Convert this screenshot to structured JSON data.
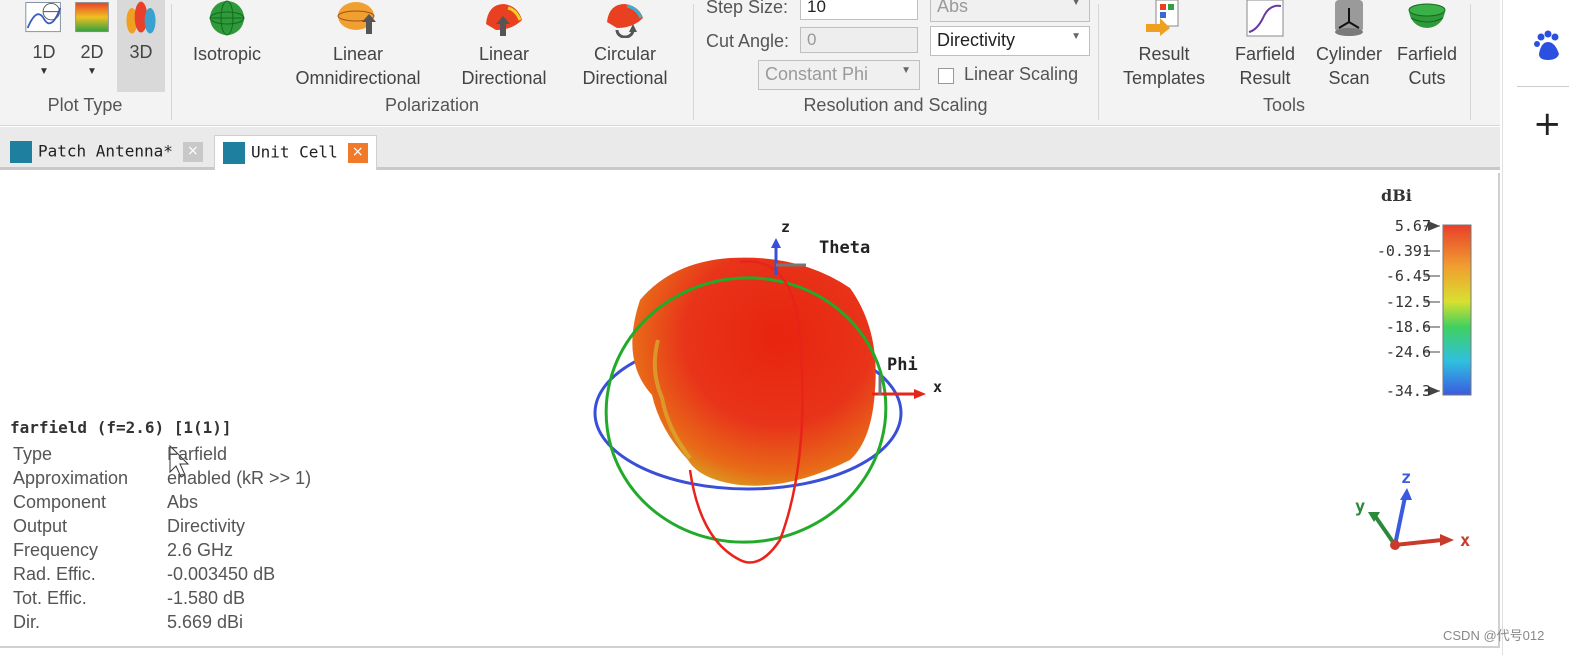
{
  "ribbon": {
    "plot_type": {
      "label": "Plot Type",
      "buttons": [
        {
          "label": "1D"
        },
        {
          "label": "2D"
        },
        {
          "label": "3D"
        }
      ]
    },
    "polarization": {
      "label": "Polarization",
      "buttons": [
        {
          "label1": "Isotropic",
          "label2": ""
        },
        {
          "label1": "Linear",
          "label2": "Omnidirectional"
        },
        {
          "label1": "Linear",
          "label2": "Directional"
        },
        {
          "label1": "Circular",
          "label2": "Directional"
        }
      ]
    },
    "resolution": {
      "label": "Resolution and Scaling",
      "step_size_label": "Step Size:",
      "step_size_value": "10",
      "cut_angle_label": "Cut Angle:",
      "cut_angle_value": "0",
      "component_value": "Abs",
      "output_value": "Directivity",
      "cut_type_value": "Constant Phi",
      "linear_scaling_label": "Linear Scaling"
    },
    "tools": {
      "label": "Tools",
      "buttons": [
        {
          "label1": "Result",
          "label2": "Templates"
        },
        {
          "label1": "Farfield",
          "label2": "Result"
        },
        {
          "label1": "Cylinder",
          "label2": "Scan"
        },
        {
          "label1": "Farfield",
          "label2": "Cuts"
        }
      ]
    }
  },
  "tabs": [
    {
      "label": "Patch Antenna*",
      "close": "×"
    },
    {
      "label": "Unit Cell",
      "close": "×"
    }
  ],
  "view": {
    "axis_labels": {
      "z": "z",
      "theta": "Theta",
      "phi": "Phi",
      "x": "x"
    },
    "triad_labels": {
      "z": "z",
      "y": "y",
      "x": "x"
    },
    "info": {
      "title": "farfield (f=2.6) [1(1)]",
      "rows": [
        {
          "key": "Type",
          "value": "Farfield"
        },
        {
          "key": "Approximation",
          "value": "enabled (kR >> 1)"
        },
        {
          "key": "Component",
          "value": "Abs"
        },
        {
          "key": "Output",
          "value": "Directivity"
        },
        {
          "key": "Frequency",
          "value": "2.6 GHz"
        },
        {
          "key": "Rad. Effic.",
          "value": "-0.003450 dB"
        },
        {
          "key": "Tot. Effic.",
          "value": "-1.580 dB"
        },
        {
          "key": "Dir.",
          "value": "5.669 dBi"
        }
      ]
    },
    "colorbar": {
      "unit": "dBi",
      "ticks": [
        "5.67",
        "-0.391",
        "-6.45",
        "-12.5",
        "-18.6",
        "-24.6",
        "-34.3"
      ]
    }
  },
  "sidebar": {
    "plus": "+"
  },
  "watermark": "CSDN @代号012",
  "colors": {
    "accent_tab_close": "#f07a2a",
    "pattern_red": "#e8341a",
    "phi_circle": "#3a4fd8",
    "theta_circle": "#22aa2a"
  }
}
